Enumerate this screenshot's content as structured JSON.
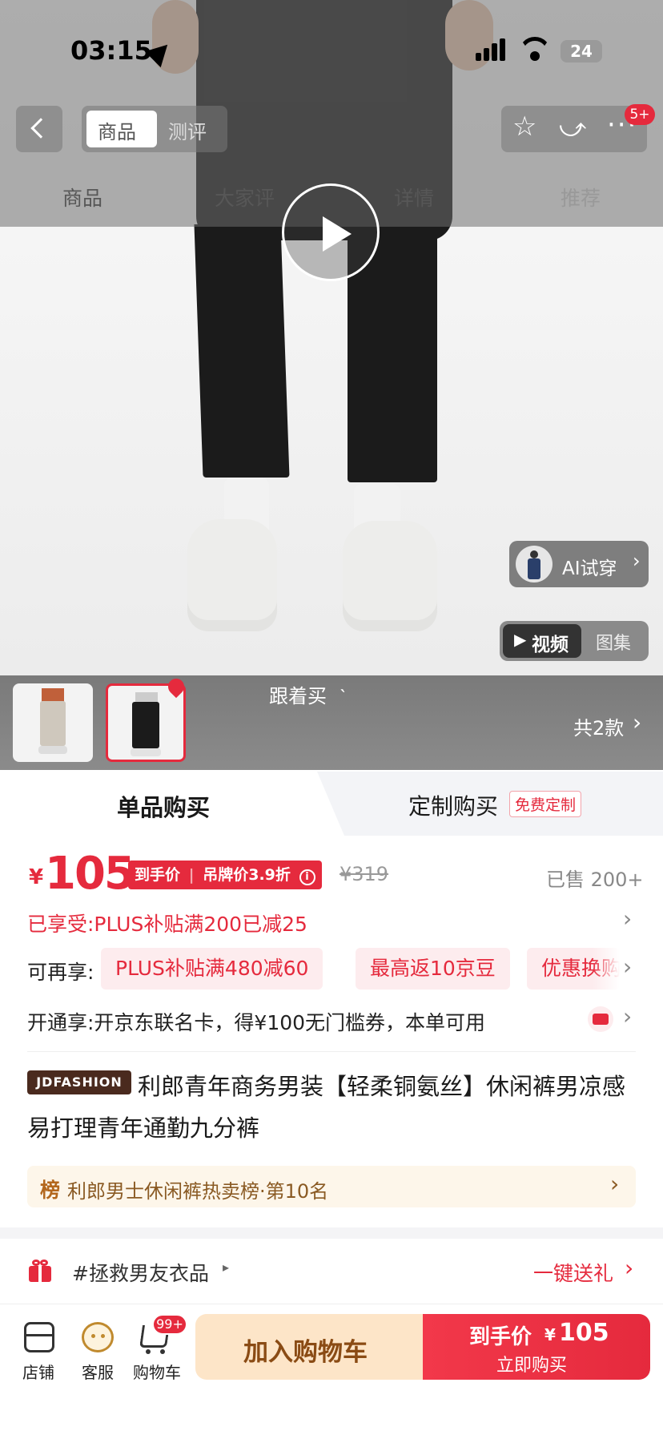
{
  "status_bar": {
    "time": "03:15",
    "battery": "24"
  },
  "top_nav": {
    "segment": [
      "商品",
      "测评"
    ],
    "badge": "5+",
    "tabs": [
      "商品",
      "大家评",
      "详情",
      "推荐"
    ]
  },
  "hero": {
    "ai_tryon_label": "AI试穿",
    "media_tabs": [
      "视频",
      "图集"
    ],
    "follow_buy": "跟着买",
    "styles_count": "共2款"
  },
  "buy_tabs": {
    "single": "单品购买",
    "custom": "定制购买",
    "custom_badge": "免费定制"
  },
  "price": {
    "currency": "¥",
    "value": "105",
    "tag_main": "到手价",
    "tag_sub": "吊牌价3.9折",
    "original": "¥319",
    "sold": "已售 200+"
  },
  "promos": {
    "enjoyed": "已享受:PLUS补贴满200已减25",
    "more_label": "可再享:",
    "chips": [
      "PLUS补贴满480减60",
      "最高返10京豆",
      "优惠换购"
    ],
    "card_offer": "开通享:开京东联名卡，得¥100无门槛券，本单可用"
  },
  "product": {
    "brand_logo": "JDFASHION",
    "title": "利郎青年商务男装【轻柔铜氨丝】休闲裤男凉感易打理青年通勤九分裤"
  },
  "ranking": {
    "icon": "榜",
    "text": "利郎男士休闲裤热卖榜·第10名"
  },
  "gift": {
    "tag": "#拯救男友衣品",
    "action": "一键送礼"
  },
  "bottom_bar": {
    "shop": "店铺",
    "service": "客服",
    "cart": "购物车",
    "cart_badge": "99+",
    "add_to_cart": "加入购物车",
    "buy_price_label": "到手价",
    "buy_price_currency": "¥",
    "buy_price_value": "105",
    "buy_now": "立即购买"
  },
  "colors": {
    "accent": "#e52a3d",
    "buy_button": "#e52a3d",
    "cart_button": "#fde5c8"
  }
}
